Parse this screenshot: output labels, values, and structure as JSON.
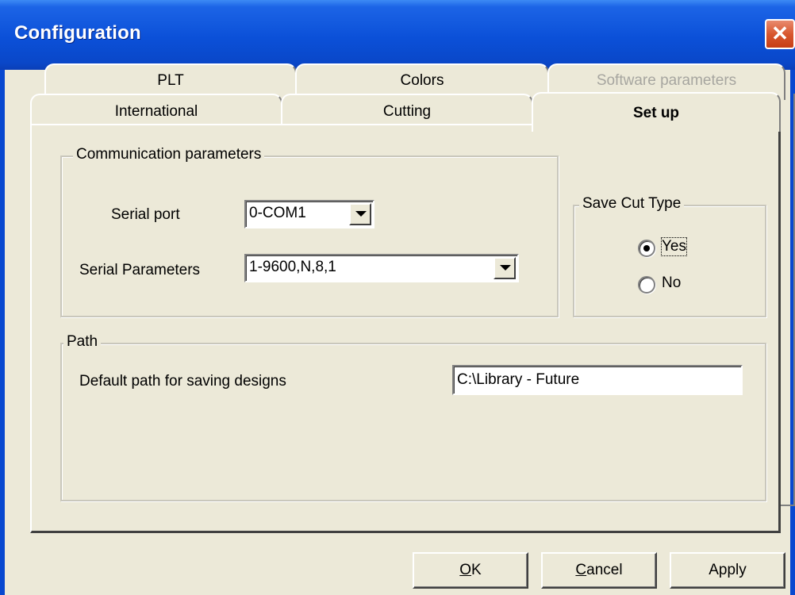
{
  "window": {
    "title": "Configuration",
    "close_glyph": "✕"
  },
  "tabs": {
    "row1": [
      "PLT",
      "Colors",
      "Software parameters"
    ],
    "row2": [
      "International",
      "Cutting",
      "Set up"
    ],
    "active": "Set up",
    "disabled": "Software parameters"
  },
  "communication": {
    "legend": "Communication parameters",
    "serial_port_label": "Serial port",
    "serial_port_value": "0-COM1",
    "serial_params_label": "Serial Parameters",
    "serial_params_value": "1-9600,N,8,1"
  },
  "save_cut_type": {
    "legend": "Save Cut Type",
    "options": [
      "Yes",
      "No"
    ],
    "selected": "Yes"
  },
  "path": {
    "legend": "Path",
    "default_path_label": "Default path for saving designs",
    "default_path_value": "C:\\Library - Future"
  },
  "buttons": {
    "ok_mnemonic": "O",
    "ok_rest": "K",
    "cancel_mnemonic": "C",
    "cancel_rest": "ancel",
    "apply": "Apply"
  },
  "colors": {
    "titlebar": "#0a50d8",
    "dialog_bg": "#ece9d8",
    "close_button": "#d8572f"
  },
  "icons": {
    "close": "close-icon",
    "dropdown": "chevron-down-icon"
  }
}
